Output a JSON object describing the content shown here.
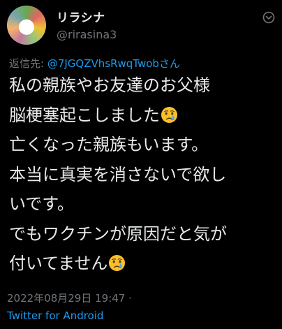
{
  "author": {
    "display_name": "リラシナ",
    "handle": "@rirasina3"
  },
  "reply": {
    "prefix": "返信先: ",
    "mention": "@7JGQZVhsRwqTwobさん"
  },
  "body_lines": [
    {
      "text": "私の親族やお友達のお父様",
      "emoji": null
    },
    {
      "text": "脳梗塞起こしました",
      "emoji": "crying-face-icon"
    },
    {
      "text": "亡くなった親族もいます。",
      "emoji": null
    },
    {
      "text": "本当に真実を消さないで欲し",
      "emoji": null
    },
    {
      "text": "いです。",
      "emoji": null
    },
    {
      "text": "でもワクチンが原因だと気が",
      "emoji": null
    },
    {
      "text": "付いてません",
      "emoji": "crying-face-icon"
    }
  ],
  "meta": {
    "timestamp": "2022年08月29日 19:47 ·",
    "source": "Twitter for Android"
  },
  "colors": {
    "background": "#000000",
    "text": "#e7e9ea",
    "secondary": "#71767b",
    "link": "#1d9bf0"
  }
}
